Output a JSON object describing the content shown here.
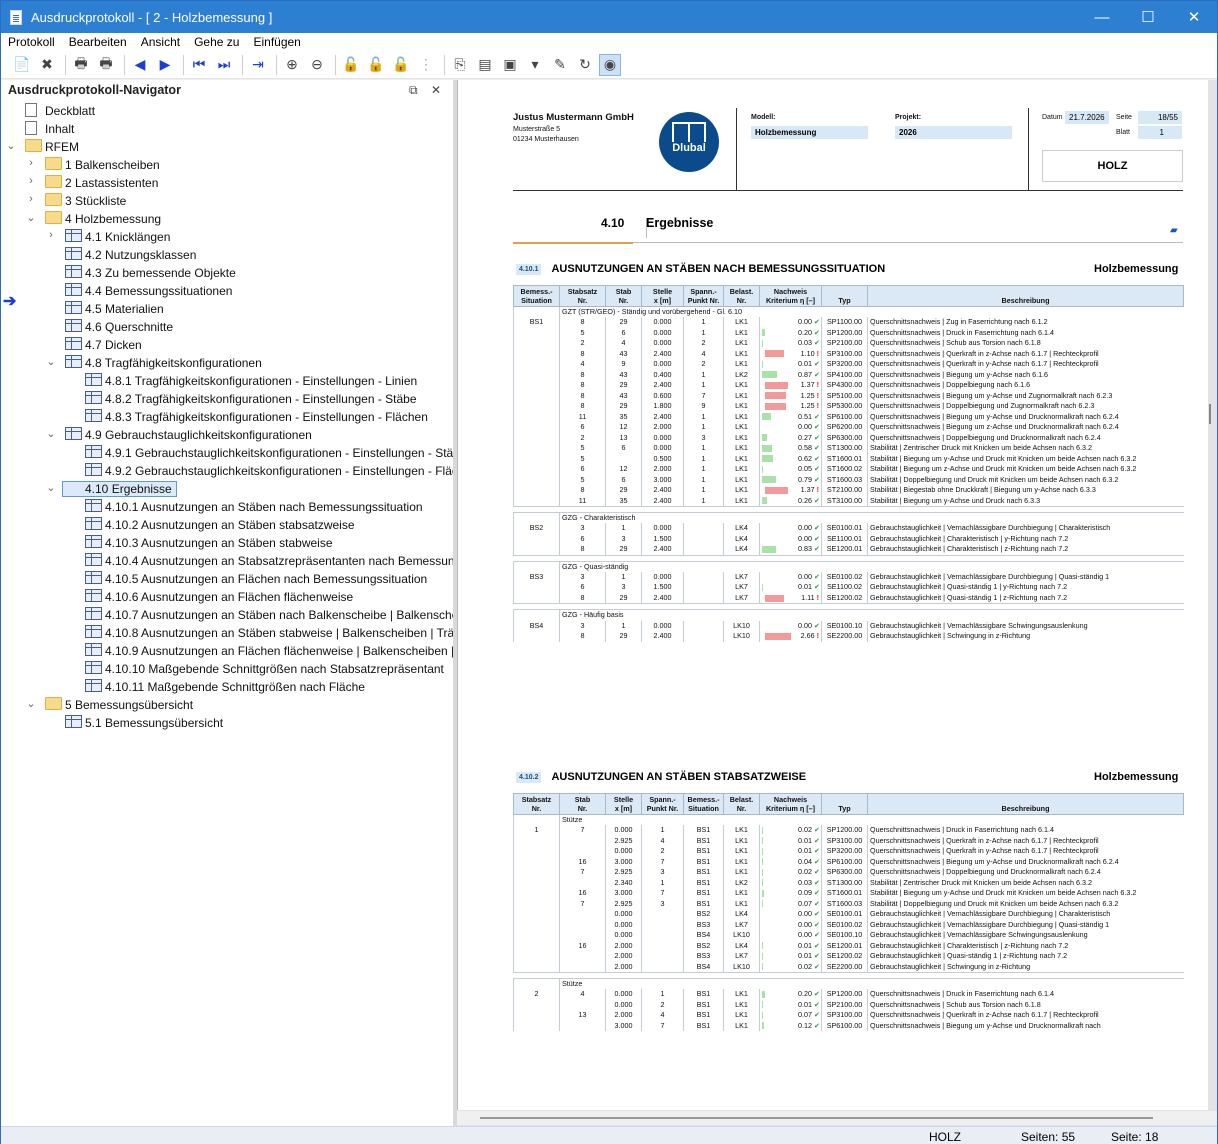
{
  "window": {
    "title": "Ausdruckprotokoll - [ 2 - Holzbemessung ]",
    "min": "—",
    "max": "☐",
    "close": "✕"
  },
  "menu": [
    "Protokoll",
    "Bearbeiten",
    "Ansicht",
    "Gehe zu",
    "Einfügen"
  ],
  "toolbar": [
    {
      "i": "📄",
      "c": "gray"
    },
    {
      "i": "✖",
      "c": "dark"
    },
    {
      "s": 1
    },
    {
      "i": "🖶",
      "c": "dark"
    },
    {
      "i": "🖶",
      "c": "dark"
    },
    {
      "s": 1
    },
    {
      "i": "◀",
      "c": "blue"
    },
    {
      "i": "▶",
      "c": "blue"
    },
    {
      "s": 1
    },
    {
      "i": "⏮",
      "c": "blue"
    },
    {
      "i": "⏭",
      "c": "blue"
    },
    {
      "s": 1
    },
    {
      "i": "⇥",
      "c": "blue"
    },
    {
      "s": 1
    },
    {
      "i": "⊕",
      "c": "dark"
    },
    {
      "i": "⊖",
      "c": "dark"
    },
    {
      "s": 1
    },
    {
      "i": "🔓",
      "c": "gray"
    },
    {
      "i": "🔓",
      "c": "gray"
    },
    {
      "i": "🔓",
      "c": "gray"
    },
    {
      "i": "⋮",
      "c": "gray"
    },
    {
      "s": 1
    },
    {
      "i": "⎘",
      "c": "dark"
    },
    {
      "i": "▤",
      "c": "dark"
    },
    {
      "i": "▣",
      "c": "dark"
    },
    {
      "i": "▾",
      "c": "dark"
    },
    {
      "i": "✎",
      "c": "dark"
    },
    {
      "i": "↻",
      "c": "dark"
    },
    {
      "i": "◉",
      "c": "dark",
      "sel": 1
    }
  ],
  "navigator": {
    "title": "Ausdruckprotokoll-Navigator",
    "pin": "⧉",
    "close": "✕",
    "items": [
      {
        "lv": 0,
        "ic": "doc",
        "t": "Deckblatt"
      },
      {
        "lv": 0,
        "ic": "doc",
        "t": "Inhalt"
      },
      {
        "lv": 0,
        "ic": "folder",
        "t": "RFEM",
        "ch": "⌄"
      },
      {
        "lv": 1,
        "ic": "folder",
        "t": "1 Balkenscheiben",
        "ch": "›"
      },
      {
        "lv": 1,
        "ic": "folder",
        "t": "2 Lastassistenten",
        "ch": "›"
      },
      {
        "lv": 1,
        "ic": "folder",
        "t": "3 Stückliste",
        "ch": "›"
      },
      {
        "lv": 1,
        "ic": "folder",
        "t": "4 Holzbemessung",
        "ch": "⌄"
      },
      {
        "lv": 2,
        "ic": "tbl",
        "t": "4.1 Knicklängen",
        "ch": "›"
      },
      {
        "lv": 2,
        "ic": "tbl",
        "t": "4.2 Nutzungsklassen"
      },
      {
        "lv": 2,
        "ic": "tbl",
        "t": "4.3 Zu bemessende Objekte"
      },
      {
        "lv": 2,
        "ic": "tbl",
        "t": "4.4 Bemessungssituationen"
      },
      {
        "lv": 2,
        "ic": "tbl",
        "t": "4.5 Materialien"
      },
      {
        "lv": 2,
        "ic": "tbl",
        "t": "4.6 Querschnitte"
      },
      {
        "lv": 2,
        "ic": "tbl",
        "t": "4.7 Dicken"
      },
      {
        "lv": 2,
        "ic": "tbl",
        "t": "4.8 Tragfähigkeitskonfigurationen",
        "ch": "⌄"
      },
      {
        "lv": 3,
        "ic": "tbl",
        "t": "4.8.1 Tragfähigkeitskonfigurationen - Einstellungen - Linien"
      },
      {
        "lv": 3,
        "ic": "tbl",
        "t": "4.8.2 Tragfähigkeitskonfigurationen - Einstellungen - Stäbe"
      },
      {
        "lv": 3,
        "ic": "tbl",
        "t": "4.8.3 Tragfähigkeitskonfigurationen - Einstellungen - Flächen"
      },
      {
        "lv": 2,
        "ic": "tbl",
        "t": "4.9 Gebrauchstauglichkeitskonfigurationen",
        "ch": "⌄"
      },
      {
        "lv": 3,
        "ic": "tbl",
        "t": "4.9.1 Gebrauchstauglichkeitskonfigurationen - Einstellungen - Stäbe"
      },
      {
        "lv": 3,
        "ic": "tbl",
        "t": "4.9.2 Gebrauchstauglichkeitskonfigurationen - Einstellungen - Flächen"
      },
      {
        "lv": 2,
        "ic": "folder",
        "t": "4.10 Ergebnisse",
        "ch": "⌄",
        "sel": 1
      },
      {
        "lv": 3,
        "ic": "tbl",
        "t": "4.10.1 Ausnutzungen an Stäben nach Bemessungssituation"
      },
      {
        "lv": 3,
        "ic": "tbl",
        "t": "4.10.2 Ausnutzungen an Stäben stabsatzweise"
      },
      {
        "lv": 3,
        "ic": "tbl",
        "t": "4.10.3 Ausnutzungen an Stäben stabweise"
      },
      {
        "lv": 3,
        "ic": "tbl",
        "t": "4.10.4 Ausnutzungen an Stabsatzrepräsentanten nach Bemessungs..."
      },
      {
        "lv": 3,
        "ic": "tbl",
        "t": "4.10.5 Ausnutzungen an Flächen nach Bemessungssituation"
      },
      {
        "lv": 3,
        "ic": "tbl",
        "t": "4.10.6 Ausnutzungen an Flächen flächenweise"
      },
      {
        "lv": 3,
        "ic": "tbl",
        "t": "4.10.7 Ausnutzungen an Stäben nach Balkenscheibe | Balkenscheibe..."
      },
      {
        "lv": 3,
        "ic": "tbl",
        "t": "4.10.8 Ausnutzungen an Stäben stabweise | Balkenscheiben | Träger"
      },
      {
        "lv": 3,
        "ic": "tbl",
        "t": "4.10.9 Ausnutzungen an Flächen flächenweise | Balkenscheiben | Be..."
      },
      {
        "lv": 3,
        "ic": "tbl",
        "t": "4.10.10 Maßgebende Schnittgrößen nach Stabsatzrepräsentant"
      },
      {
        "lv": 3,
        "ic": "tbl",
        "t": "4.10.11 Maßgebende Schnittgrößen nach Fläche"
      },
      {
        "lv": 1,
        "ic": "folder",
        "t": "5 Bemessungsübersicht",
        "ch": "⌄"
      },
      {
        "lv": 2,
        "ic": "tbl",
        "t": "5.1 Bemessungsübersicht"
      }
    ]
  },
  "header": {
    "company": "Justus Mustermann GmbH",
    "street": "Musterstraße 5",
    "city": "01234 Musterhausen",
    "logo": "Dlubal",
    "modell_label": "Modell:",
    "modell": "Holzbemessung",
    "projekt_label": "Projekt:",
    "projekt": "2026",
    "datum_label": "Datum",
    "datum": "21.7.2026",
    "seite_label": "Seite",
    "seite": "18/55",
    "blatt_label": "Blatt",
    "blatt": "1",
    "stamp": "HOLZ"
  },
  "section": {
    "num": "4.10",
    "title": "Ergebnisse"
  },
  "t1": {
    "num": "4.10.1",
    "title": "AUSNUTZUNGEN AN STÄBEN NACH BEMESSUNGSSITUATION",
    "right": "Holzbemessung",
    "cols": [
      "Bemess.-\nSituation",
      "Stabsatz\nNr.",
      "Stab\nNr.",
      "Stelle\nx [m]",
      "Spann.-\nPunkt Nr.",
      "Belast.\nNr.",
      "Kriterium η [–]",
      "Typ",
      "Beschreibung"
    ],
    "nachweis": "Nachweis",
    "rows": [
      [
        "g",
        "GZT (STR/GEO) - Ständig und vorübergehend - Gl. 6.10"
      ],
      [
        "BS1",
        "8",
        "29",
        "0.000",
        "1",
        "LK1",
        "0.00",
        "SP1100.00",
        "Querschnittsnachweis | Zug in Faserrichtung nach 6.1.2"
      ],
      [
        "",
        "5",
        "6",
        "0.000",
        "1",
        "LK1",
        "0.20",
        "SP1200.00",
        "Querschnittsnachweis | Druck in Faserrichtung nach 6.1.4"
      ],
      [
        "",
        "2",
        "4",
        "0.000",
        "2",
        "LK1",
        "0.03",
        "SP2100.00",
        "Querschnittsnachweis | Schub aus Torsion nach 6.1.8"
      ],
      [
        "",
        "8",
        "43",
        "2.400",
        "4",
        "LK1",
        "1.10",
        "SP3100.00",
        "Querschnittsnachweis | Querkraft in z-Achse nach 6.1.7 | Rechteckprofil"
      ],
      [
        "",
        "4",
        "9",
        "0.000",
        "2",
        "LK1",
        "0.01",
        "SP3200.00",
        "Querschnittsnachweis | Querkraft in y-Achse nach 6.1.7 | Rechteckprofil"
      ],
      [
        "",
        "8",
        "43",
        "0.400",
        "1",
        "LK2",
        "0.87",
        "SP4100.00",
        "Querschnittsnachweis | Biegung um y-Achse nach 6.1.6"
      ],
      [
        "",
        "8",
        "29",
        "2.400",
        "1",
        "LK1",
        "1.37",
        "SP4300.00",
        "Querschnittsnachweis | Doppelbiegung nach 6.1.6"
      ],
      [
        "",
        "8",
        "43",
        "0.600",
        "7",
        "LK1",
        "1.25",
        "SP5100.00",
        "Querschnittsnachweis | Biegung um y-Achse und Zugnormalkraft nach 6.2.3"
      ],
      [
        "",
        "8",
        "29",
        "1.800",
        "9",
        "LK1",
        "1.25",
        "SP5300.00",
        "Querschnittsnachweis | Doppelbiegung und Zugnormalkraft nach 6.2.3"
      ],
      [
        "",
        "11",
        "35",
        "2.400",
        "1",
        "LK1",
        "0.51",
        "SP6100.00",
        "Querschnittsnachweis | Biegung um y-Achse und Drucknormalkraft nach 6.2.4"
      ],
      [
        "",
        "6",
        "12",
        "2.000",
        "1",
        "LK1",
        "0.00",
        "SP6200.00",
        "Querschnittsnachweis | Biegung um z-Achse und Drucknormalkraft nach 6.2.4"
      ],
      [
        "",
        "2",
        "13",
        "0.000",
        "3",
        "LK1",
        "0.27",
        "SP6300.00",
        "Querschnittsnachweis | Doppelbiegung und Drucknormalkraft nach 6.2.4"
      ],
      [
        "",
        "5",
        "6",
        "0.000",
        "1",
        "LK1",
        "0.58",
        "ST1300.00",
        "Stabilität | Zentrischer Druck mit Knicken um beide Achsen nach 6.3.2"
      ],
      [
        "",
        "5",
        "",
        "0.500",
        "1",
        "LK1",
        "0.62",
        "ST1600.01",
        "Stabilität | Biegung um y-Achse und Druck mit Knicken um beide Achsen nach 6.3.2"
      ],
      [
        "",
        "6",
        "12",
        "2.000",
        "1",
        "LK1",
        "0.05",
        "ST1600.02",
        "Stabilität | Biegung um z-Achse und Druck mit Knicken um beide Achsen nach 6.3.2"
      ],
      [
        "",
        "5",
        "6",
        "3.000",
        "1",
        "LK1",
        "0.79",
        "ST1600.03",
        "Stabilität | Doppelbiegung und Druck mit Knicken um beide Achsen nach 6.3.2"
      ],
      [
        "",
        "8",
        "29",
        "2.400",
        "1",
        "LK1",
        "1.37",
        "ST2100.00",
        "Stabilität | Biegestab ohne Druckkraft | Biegung um y-Achse nach 6.3.3"
      ],
      [
        "",
        "11",
        "35",
        "2.400",
        "1",
        "LK1",
        "0.26",
        "ST3100.00",
        "Stabilität | Biegung um y-Achse und Druck nach 6.3.3"
      ],
      [
        "s"
      ],
      [
        "g",
        "GZG - Charakteristisch"
      ],
      [
        "BS2",
        "3",
        "1",
        "0.000",
        "",
        "LK4",
        "0.00",
        "SE0100.01",
        "Gebrauchstauglichkeit | Vernachlässigbare Durchbiegung | Charakteristisch"
      ],
      [
        "",
        "6",
        "3",
        "1.500",
        "",
        "LK4",
        "0.00",
        "SE1100.01",
        "Gebrauchstauglichkeit | Charakteristisch | y-Richtung nach 7.2"
      ],
      [
        "",
        "8",
        "29",
        "2.400",
        "",
        "LK4",
        "0.83",
        "SE1200.01",
        "Gebrauchstauglichkeit | Charakteristisch | z-Richtung nach 7.2"
      ],
      [
        "s"
      ],
      [
        "g",
        "GZG - Quasi-ständig"
      ],
      [
        "BS3",
        "3",
        "1",
        "0.000",
        "",
        "LK7",
        "0.00",
        "SE0100.02",
        "Gebrauchstauglichkeit | Vernachlässigbare Durchbiegung | Quasi-ständig 1"
      ],
      [
        "",
        "6",
        "3",
        "1.500",
        "",
        "LK7",
        "0.01",
        "SE1100.02",
        "Gebrauchstauglichkeit | Quasi-ständig 1 | y-Richtung nach 7.2"
      ],
      [
        "",
        "8",
        "29",
        "2.400",
        "",
        "LK7",
        "1.11",
        "SE1200.02",
        "Gebrauchstauglichkeit | Quasi-ständig 1 | z-Richtung nach 7.2"
      ],
      [
        "s"
      ],
      [
        "g",
        "GZG - Häufig basis"
      ],
      [
        "BS4",
        "3",
        "1",
        "0.000",
        "",
        "LK10",
        "0.00",
        "SE0100.10",
        "Gebrauchstauglichkeit | Vernachlässigbare Schwingungsauslenkung"
      ],
      [
        "",
        "8",
        "29",
        "2.400",
        "",
        "LK10",
        "2.66",
        "SE2200.00",
        "Gebrauchstauglichkeit | Schwingung in z-Richtung"
      ]
    ]
  },
  "t2": {
    "num": "4.10.2",
    "title": "AUSNUTZUNGEN AN STÄBEN STABSATZWEISE",
    "right": "Holzbemessung",
    "cols": [
      "Stabsatz\nNr.",
      "Stab\nNr.",
      "Stelle\nx [m]",
      "Spann.-\nPunkt Nr.",
      "Bemess.-\nSituation",
      "Belast.\nNr.",
      "Kriterium η [–]",
      "Typ",
      "Beschreibung"
    ],
    "nachweis": "Nachweis",
    "rows": [
      [
        "g",
        "Stütze"
      ],
      [
        "1",
        "7",
        "0.000",
        "1",
        "BS1",
        "LK1",
        "0.02",
        "SP1200.00",
        "Querschnittsnachweis | Druck in Faserrichtung nach 6.1.4"
      ],
      [
        "",
        "",
        "2.925",
        "4",
        "BS1",
        "LK1",
        "0.01",
        "SP3100.00",
        "Querschnittsnachweis | Querkraft in z-Achse nach 6.1.7 | Rechteckprofil"
      ],
      [
        "",
        "",
        "0.000",
        "2",
        "BS1",
        "LK1",
        "0.01",
        "SP3200.00",
        "Querschnittsnachweis | Querkraft in y-Achse nach 6.1.7 | Rechteckprofil"
      ],
      [
        "",
        "16",
        "3.000",
        "7",
        "BS1",
        "LK1",
        "0.04",
        "SP6100.00",
        "Querschnittsnachweis | Biegung um y-Achse und Drucknormalkraft nach 6.2.4"
      ],
      [
        "",
        "7",
        "2.925",
        "3",
        "BS1",
        "LK1",
        "0.02",
        "SP6300.00",
        "Querschnittsnachweis | Doppelbiegung und Drucknormalkraft nach 6.2.4"
      ],
      [
        "",
        "",
        "2.340",
        "1",
        "BS1",
        "LK2",
        "0.03",
        "ST1300.00",
        "Stabilität | Zentrischer Druck mit Knicken um beide Achsen nach 6.3.2"
      ],
      [
        "",
        "16",
        "3.000",
        "7",
        "BS1",
        "LK1",
        "0.09",
        "ST1600.01",
        "Stabilität | Biegung um y-Achse und Druck mit Knicken um beide Achsen nach 6.3.2"
      ],
      [
        "",
        "7",
        "2.925",
        "3",
        "BS1",
        "LK1",
        "0.07",
        "ST1600.03",
        "Stabilität | Doppelbiegung und Druck mit Knicken um beide Achsen nach 6.3.2"
      ],
      [
        "",
        "",
        "0.000",
        "",
        "BS2",
        "LK4",
        "0.00",
        "SE0100.01",
        "Gebrauchstauglichkeit | Vernachlässigbare Durchbiegung | Charakteristisch"
      ],
      [
        "",
        "",
        "0.000",
        "",
        "BS3",
        "LK7",
        "0.00",
        "SE0100.02",
        "Gebrauchstauglichkeit | Vernachlässigbare Durchbiegung | Quasi-ständig 1"
      ],
      [
        "",
        "",
        "0.000",
        "",
        "BS4",
        "LK10",
        "0.00",
        "SE0100.10",
        "Gebrauchstauglichkeit | Vernachlässigbare Schwingungsauslenkung"
      ],
      [
        "",
        "16",
        "2.000",
        "",
        "BS2",
        "LK4",
        "0.01",
        "SE1200.01",
        "Gebrauchstauglichkeit | Charakteristisch | z-Richtung nach 7.2"
      ],
      [
        "",
        "",
        "2.000",
        "",
        "BS3",
        "LK7",
        "0.01",
        "SE1200.02",
        "Gebrauchstauglichkeit | Quasi-ständig 1 | z-Richtung nach 7.2"
      ],
      [
        "",
        "",
        "2.000",
        "",
        "BS4",
        "LK10",
        "0.02",
        "SE2200.00",
        "Gebrauchstauglichkeit | Schwingung in z-Richtung"
      ],
      [
        "s"
      ],
      [
        "g",
        "Stütze"
      ],
      [
        "2",
        "4",
        "0.000",
        "1",
        "BS1",
        "LK1",
        "0.20",
        "SP1200.00",
        "Querschnittsnachweis | Druck in Faserrichtung nach 6.1.4"
      ],
      [
        "",
        "",
        "0.000",
        "2",
        "BS1",
        "LK1",
        "0.01",
        "SP2100.00",
        "Querschnittsnachweis | Schub aus Torsion nach 6.1.8"
      ],
      [
        "",
        "13",
        "2.000",
        "4",
        "BS1",
        "LK1",
        "0.07",
        "SP3100.00",
        "Querschnittsnachweis | Querkraft in z-Achse nach 6.1.7 | Rechteckprofil"
      ],
      [
        "",
        "",
        "3.000",
        "7",
        "BS1",
        "LK1",
        "0.12",
        "SP6100.00",
        "Querschnittsnachweis | Biegung um y-Achse und Drucknormalkraft nach"
      ]
    ]
  },
  "status": {
    "left": "HOLZ",
    "pages": "Seiten: 55",
    "page": "Seite: 18"
  }
}
